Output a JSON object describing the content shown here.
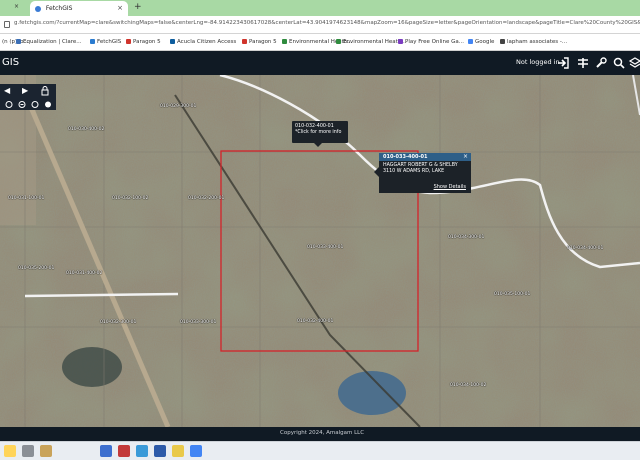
{
  "browser": {
    "tab_edge_label": "×",
    "tab_title": "FetchGIS",
    "tab_close": "×",
    "new_tab": "+",
    "url": "g.fetchgis.com/?currentMap=clare&switchingMaps=false&centerLng=-84.914223430617028&centerLat=43.9041974623148&mapZoom=16&pageSize=letter&pageOrientation=landscape&pageTitle=Clare%20County%20GIS&subTitle=&northA"
  },
  "bookmarks": [
    {
      "label": "Equalization | Clare...",
      "color": "#3b6fb6"
    },
    {
      "label": "FetchGIS",
      "color": "#2a7bd0"
    },
    {
      "label": "Paragon 5",
      "color": "#d0342c"
    },
    {
      "label": "Acucla Citizen Access",
      "color": "#0d5d9e"
    },
    {
      "label": "Paragon 5",
      "color": "#d0342c"
    },
    {
      "label": "Environmental Heath...",
      "color": "#2f8b3e"
    },
    {
      "label": "Environmental Heath...",
      "color": "#2f8b3e"
    },
    {
      "label": "Play Free Online Ga...",
      "color": "#7a3bc0"
    },
    {
      "label": "Google",
      "color": "#4285f4"
    },
    {
      "label": "lapham associates -...",
      "color": "#444444"
    }
  ],
  "bookmark_first": "(n (p)Fo...",
  "app": {
    "title": "GIS",
    "login_status": "Not logged in"
  },
  "map": {
    "tools": {
      "back": "◀",
      "forward": "▶"
    },
    "hover_callout": {
      "line1": "010-032-400-01",
      "line2": "*Click for more info"
    },
    "popup": {
      "parcel_id": "010-033-400-01",
      "owner": "HAGGART ROBERT G & SHELBY",
      "address": "3110 W ADAMS RD, LAKE",
      "link": "Show Details",
      "close": "×"
    },
    "parcel_labels": [
      {
        "text": "010-029-300-01"
      },
      {
        "text": "010-030-400-02"
      },
      {
        "text": "010-031-100-01"
      },
      {
        "text": "010-032-100-02"
      },
      {
        "text": "010-032-200-01"
      },
      {
        "text": "010-033-400-01"
      },
      {
        "text": "010-034-300-01"
      },
      {
        "text": "010-034-400-01"
      },
      {
        "text": "010-035-100-01"
      },
      {
        "text": "010-035-200-01"
      },
      {
        "text": "010-031-400-02"
      },
      {
        "text": "010-032-300-01"
      },
      {
        "text": "010-033-300-01"
      },
      {
        "text": "010-034-100-02"
      },
      {
        "text": "010-032-400-01"
      }
    ]
  },
  "footer": {
    "copyright": "Copyright 2024, Amalgam LLC"
  },
  "colors": {
    "header_bg": "#101a24",
    "parcel_outline": "#d4232a",
    "popup_header": "#2e5f88",
    "tabstrip": "#a8d9a4"
  }
}
